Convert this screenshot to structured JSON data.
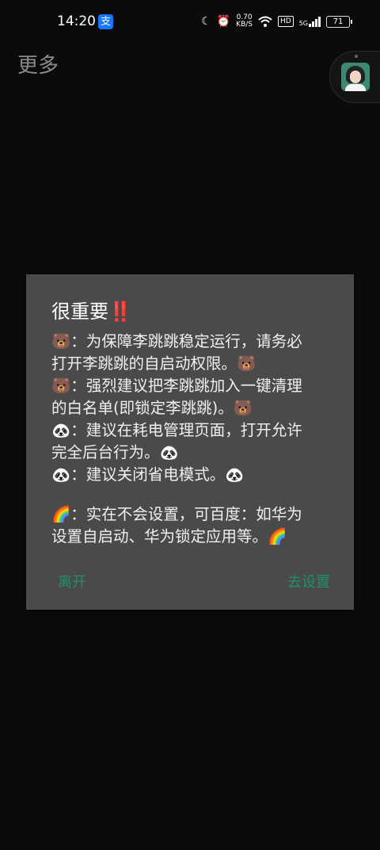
{
  "status_bar": {
    "time": "14:20",
    "app_badge": "支",
    "net_speed_value": "0.70",
    "net_speed_unit": "KB/S",
    "hd_label": "HD",
    "signal_label": "5G",
    "battery": "71"
  },
  "header": {
    "title": "更多"
  },
  "dialog": {
    "title": "很重要‼️",
    "lines": [
      "🐻：为保障李跳跳稳定运行，请务必",
      "打开李跳跳的自启动权限。🐻",
      "🐻：强烈建议把李跳跳加入一键清理",
      "的白名单(即锁定李跳跳)。🐻",
      "🐼：建议在耗电管理页面，打开允许",
      "完全后台行为。🐼",
      "🐼：建议关闭省电模式。🐼",
      "",
      "🌈：实在不会设置，可百度：如华为",
      "设置自启动、华为锁定应用等。🌈"
    ],
    "negative_label": "离开",
    "positive_label": "去设置"
  },
  "colors": {
    "background": "#0b0b0b",
    "dialog": "#4a4a4a",
    "accent": "#1e8f6e"
  }
}
